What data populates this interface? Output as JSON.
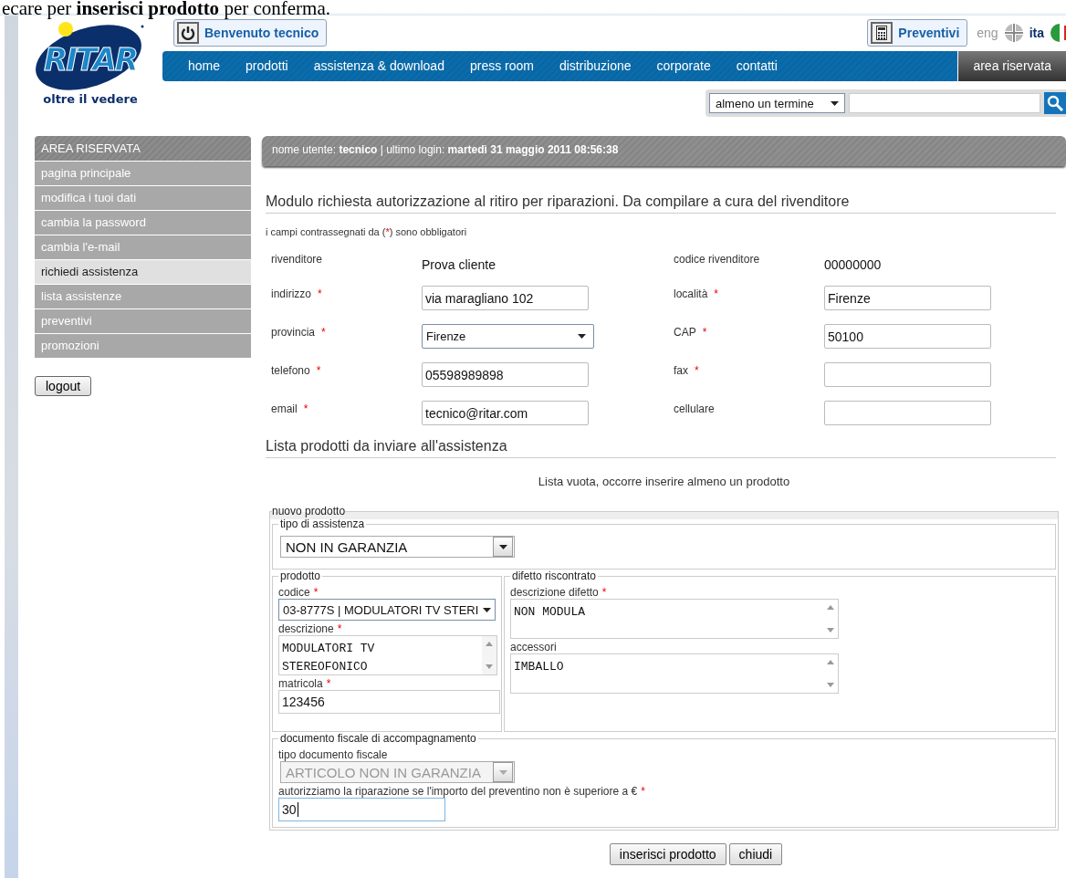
{
  "caption": "ecare per **inserisci prodotto** per conferma.",
  "logo": {
    "name": "RITAR",
    "tagline": "oltre il **vedere**"
  },
  "header": {
    "welcome_button": "Benvenuto tecnico",
    "quotes_button": "Preventivi",
    "languages": [
      {
        "label": "eng",
        "selected": false
      },
      {
        "label": "ita",
        "selected": true
      }
    ]
  },
  "nav": [
    {
      "label": "home",
      "selected": false
    },
    {
      "label": "prodotti",
      "selected": false
    },
    {
      "label": "assistenza & download",
      "selected": false
    },
    {
      "label": "press room",
      "selected": false
    },
    {
      "label": "distribuzione",
      "selected": false
    },
    {
      "label": "corporate",
      "selected": false
    },
    {
      "label": "contatti",
      "selected": false
    },
    {
      "label": "area riservata",
      "selected": true
    }
  ],
  "search": {
    "mode": "almeno un termine"
  },
  "sidebar": {
    "title": "AREA RISERVATA",
    "items": [
      {
        "label": "pagina principale",
        "selected": false
      },
      {
        "label": "modifica i tuoi dati",
        "selected": false
      },
      {
        "label": "cambia la password",
        "selected": false
      },
      {
        "label": "cambia l'e-mail",
        "selected": false
      },
      {
        "label": "richiedi assistenza",
        "selected": true
      },
      {
        "label": "lista assistenze",
        "selected": false
      },
      {
        "label": "preventivi",
        "selected": false
      },
      {
        "label": "promozioni",
        "selected": false
      }
    ],
    "logout": "logout"
  },
  "user_bar": "nome utente: **tecnico** | ultimo login: **martedì 31 maggio 2011 08:56:38**",
  "form": {
    "title": "Modulo richiesta autorizzazione al ritiro per riparazioni. Da compilare a cura del rivenditore",
    "note": {
      "before": "i campi contrassegnati da (",
      "mark": "*",
      "after": ") sono obbligatori"
    },
    "fields": [
      {
        "label": "rivenditore",
        "kind": "static",
        "value": "Prova cliente"
      },
      {
        "label": "codice rivenditore",
        "kind": "static",
        "value": "00000000"
      },
      {
        "label": "indirizzo",
        "mark": "*",
        "kind": "text",
        "value": "via maragliano 102"
      },
      {
        "label": "località",
        "mark": "*",
        "kind": "text",
        "value": "Firenze"
      },
      {
        "label": "provincia",
        "mark": "*",
        "kind": "select",
        "value": "Firenze"
      },
      {
        "label": "CAP",
        "mark": "*",
        "kind": "text",
        "value": "50100"
      },
      {
        "label": "telefono",
        "mark": "*",
        "kind": "text",
        "value": "05598989898"
      },
      {
        "label": "fax",
        "mark": "*",
        "kind": "text"
      },
      {
        "label": "email",
        "mark": "*",
        "kind": "text",
        "value": "tecnico@ritar.com"
      },
      {
        "label": "cellulare",
        "kind": "text"
      }
    ]
  },
  "products": {
    "title": "Lista prodotti da inviare all'assistenza",
    "empty": "Lista vuota, occorre inserire almeno un prodotto"
  },
  "new_product": {
    "legend": "nuovo prodotto",
    "assistance": {
      "legend": "tipo di assistenza",
      "value": "NON IN GARANZIA"
    },
    "product": {
      "legend": "prodotto",
      "fields": [
        {
          "label": "codice",
          "mark": "*",
          "kind": "select",
          "value": "03-8777S | MODULATORI TV STERI"
        },
        {
          "label": "descrizione",
          "mark": "*",
          "kind": "textarea",
          "value": "MODULATORI TV\nSTEREOFONICO"
        },
        {
          "label": "matricola",
          "mark": "*",
          "kind": "text",
          "value": "123456"
        }
      ]
    },
    "defect": {
      "legend": "difetto riscontrato",
      "fields": [
        {
          "label": "descrizione difetto",
          "mark": "*",
          "kind": "textarea",
          "value": "NON MODULA"
        },
        {
          "label": "accessori",
          "kind": "textarea",
          "value": "IMBALLO"
        }
      ]
    },
    "fiscal": {
      "legend": "documento fiscale di accompagnamento",
      "fields": [
        {
          "label": "tipo documento fiscale",
          "kind": "select",
          "value": "ARTICOLO NON IN GARANZIA",
          "disabled": true
        },
        {
          "label": "autorizziamo la riparazione se l'importo del preventino non è superiore a €",
          "mark": "*",
          "kind": "text",
          "value": "30",
          "focused": true
        }
      ]
    }
  },
  "buttons": [
    "inserisci prodotto",
    "chiudi"
  ]
}
